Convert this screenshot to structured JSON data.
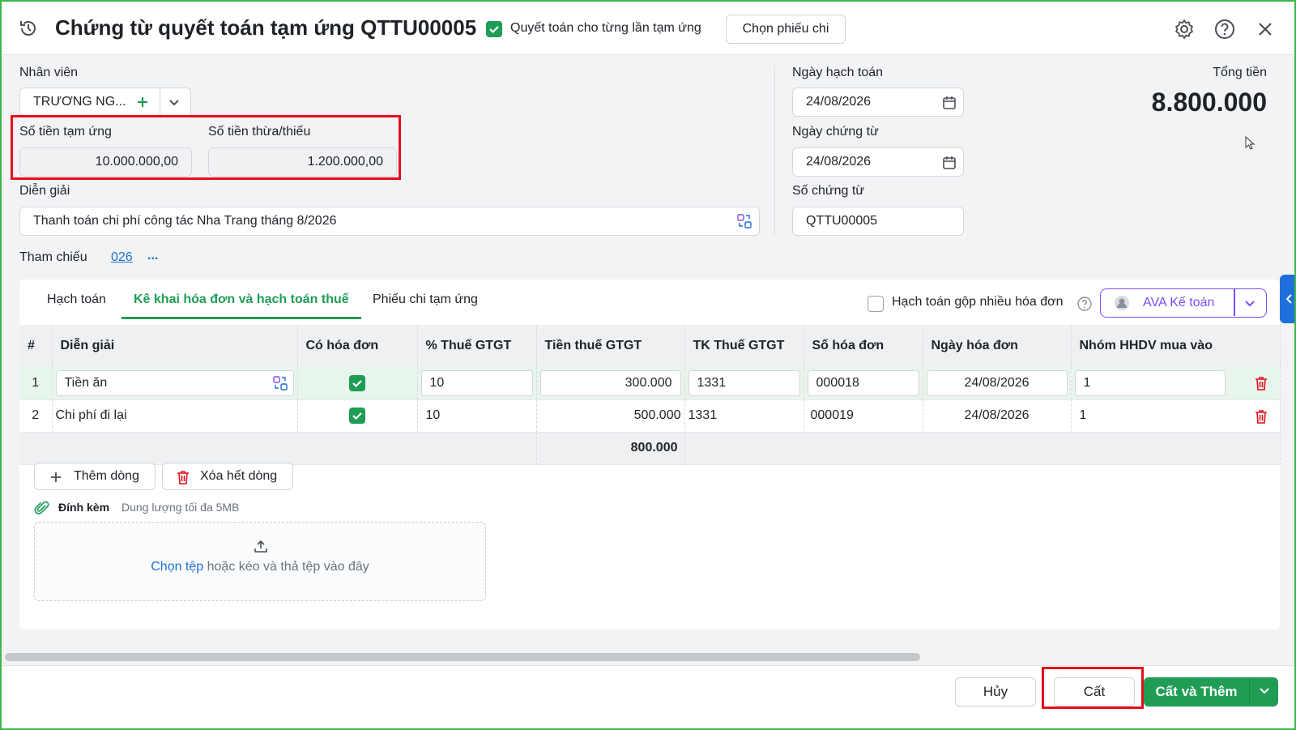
{
  "header": {
    "title": "Chứng từ quyết toán tạm ứng QTTU00005",
    "settle_each_label": "Quyết toán cho từng lần tạm ứng",
    "settle_each_checked": true,
    "choose_voucher_label": "Chọn phiếu chi"
  },
  "form": {
    "employee_label": "Nhân viên",
    "employee_value": "TRƯƠNG NG...",
    "advance_amount_label": "Số tiền tạm ứng",
    "advance_amount_value": "10.000.000,00",
    "diff_amount_label": "Số tiền thừa/thiếu",
    "diff_amount_value": "1.200.000,00",
    "description_label": "Diễn giải",
    "description_value": "Thanh toán chi phí công tác Nha Trang tháng 8/2026",
    "posting_date_label": "Ngày hạch toán",
    "posting_date_value": "24/08/2026",
    "voucher_date_label": "Ngày chứng từ",
    "voucher_date_value": "24/08/2026",
    "voucher_no_label": "Số chứng từ",
    "voucher_no_value": "QTTU00005",
    "total_label": "Tổng tiền",
    "total_value": "8.800.000",
    "reference_label": "Tham chiếu",
    "reference_value": "026",
    "reference_more": "..."
  },
  "tabs": [
    {
      "label": "Hạch toán",
      "active": false
    },
    {
      "label": "Kê khai hóa đơn và hạch toán thuế",
      "active": true
    },
    {
      "label": "Phiếu chi tạm ứng",
      "active": false
    }
  ],
  "merge_invoices_label": "Hạch toán gộp nhiều hóa đơn",
  "ava_label": "AVA Kế toán",
  "table": {
    "headers": [
      "#",
      "Diễn giải",
      "Có hóa đơn",
      "% Thuế GTGT",
      "Tiền thuế GTGT",
      "TK Thuế GTGT",
      "Số hóa đơn",
      "Ngày hóa đơn",
      "Nhóm HHDV mua vào"
    ],
    "rows": [
      {
        "no": "1",
        "desc": "Tiền ăn",
        "has_invoice": true,
        "vat_pct": "10",
        "vat_amount": "300.000",
        "vat_account": "1331",
        "invoice_no": "000018",
        "invoice_date": "24/08/2026",
        "group": "1"
      },
      {
        "no": "2",
        "desc": "Chi phí đi lại",
        "has_invoice": true,
        "vat_pct": "10",
        "vat_amount": "500.000",
        "vat_account": "1331",
        "invoice_no": "000019",
        "invoice_date": "24/08/2026",
        "group": "1"
      }
    ],
    "sum_vat_amount": "800.000"
  },
  "actions": {
    "add_row": "Thêm dòng",
    "delete_all": "Xóa hết dòng"
  },
  "attachment": {
    "label": "Đính kèm",
    "hint": "Dung lượng tối đa 5MB",
    "choose_link": "Chọn tệp",
    "drop_text": " hoặc kéo và thả tệp vào đây"
  },
  "footer": {
    "cancel": "Hủy",
    "save": "Cất",
    "save_and_add": "Cất và Thêm"
  },
  "colors": {
    "accent_green": "#1f9d55",
    "link_blue": "#1e6fd9",
    "highlight_red": "#e3101c",
    "ava_purple": "#7b4cf5"
  }
}
